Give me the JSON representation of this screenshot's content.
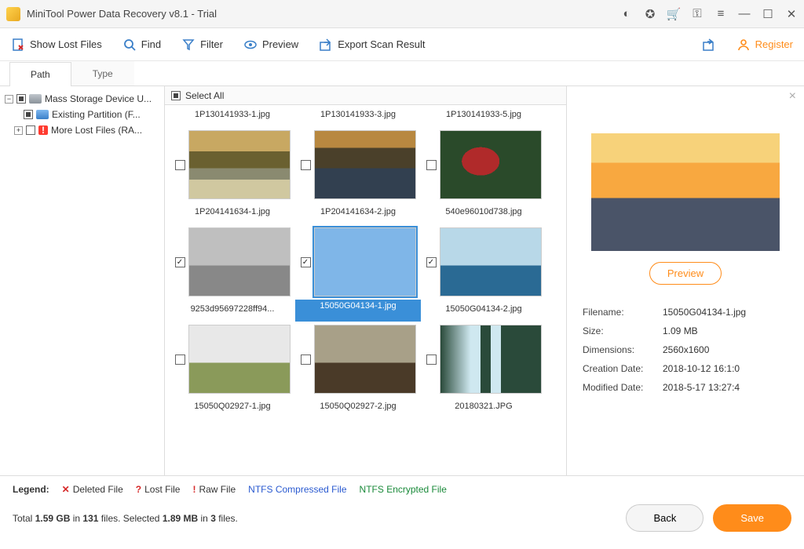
{
  "app": {
    "title": "MiniTool Power Data Recovery v8.1 - Trial"
  },
  "toolbar": {
    "show_lost": "Show Lost Files",
    "find": "Find",
    "filter": "Filter",
    "preview": "Preview",
    "export": "Export Scan Result",
    "register": "Register"
  },
  "tabs": {
    "path": "Path",
    "type": "Type"
  },
  "tree": {
    "root": "Mass Storage Device U...",
    "partition": "Existing Partition (F...",
    "rawfiles": "More Lost Files (RA..."
  },
  "grid": {
    "select_all": "Select All",
    "items": [
      {
        "name": "1P130141933-1.jpg",
        "scene": "sc-trees",
        "checked": false
      },
      {
        "name": "1P130141933-3.jpg",
        "scene": "sc-reflect",
        "checked": false
      },
      {
        "name": "1P130141933-5.jpg",
        "scene": "sc-flower",
        "checked": false
      },
      {
        "name": "1P204141634-1.jpg",
        "scene": "sc-trees",
        "checked": false
      },
      {
        "name": "1P204141634-2.jpg",
        "scene": "sc-reflect",
        "checked": false
      },
      {
        "name": "540e96010d738.jpg",
        "scene": "sc-flower",
        "checked": false
      },
      {
        "name": "9253d95697228ff94...",
        "scene": "sc-cat",
        "checked": true
      },
      {
        "name": "15050G04134-1.jpg",
        "scene": "sc-dolph1",
        "checked": true,
        "selected": true
      },
      {
        "name": "15050G04134-2.jpg",
        "scene": "sc-dolph2",
        "checked": true
      },
      {
        "name": "15050Q02927-1.jpg",
        "scene": "sc-eleph",
        "checked": false
      },
      {
        "name": "15050Q02927-2.jpg",
        "scene": "sc-lion",
        "checked": false
      },
      {
        "name": "20180321.JPG",
        "scene": "sc-wfall",
        "checked": false
      }
    ]
  },
  "preview": {
    "btn": "Preview",
    "labels": {
      "filename": "Filename:",
      "size": "Size:",
      "dims": "Dimensions:",
      "created": "Creation Date:",
      "modified": "Modified Date:"
    },
    "filename": "15050G04134-1.jpg",
    "size": "1.09 MB",
    "dims": "2560x1600",
    "created": "2018-10-12 16:1:0",
    "modified": "2018-5-17 13:27:4"
  },
  "legend": {
    "title": "Legend:",
    "deleted": "Deleted File",
    "lost": "Lost File",
    "raw": "Raw File",
    "ntfs_comp": "NTFS Compressed File",
    "ntfs_enc": "NTFS Encrypted File"
  },
  "stats": {
    "text_a": "Total ",
    "total_size": "1.59 GB",
    "text_b": " in ",
    "total_files": "131",
    "text_c": " files.  Selected ",
    "sel_size": "1.89 MB",
    "text_d": " in ",
    "sel_files": "3",
    "text_e": " files."
  },
  "buttons": {
    "back": "Back",
    "save": "Save"
  }
}
